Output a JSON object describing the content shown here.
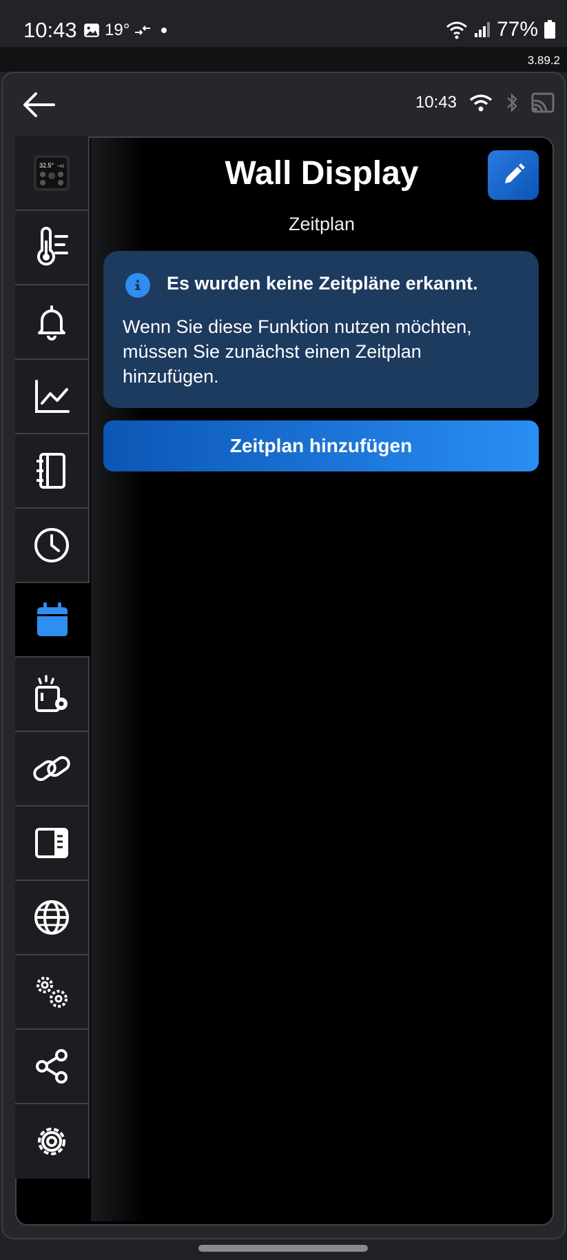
{
  "status_bar": {
    "time": "10:43",
    "temperature": "19°",
    "battery": "77%",
    "icons": [
      "image-icon",
      "swap-icon",
      "dot-icon",
      "wifi-icon",
      "signal-icon",
      "battery-icon"
    ]
  },
  "version": "3.89.2",
  "header": {
    "time": "10:43",
    "icons": [
      "back-arrow-icon",
      "wifi-icon",
      "bluetooth-icon",
      "cast-icon"
    ]
  },
  "sidebar": {
    "items": [
      {
        "name": "device-thumbnail",
        "icon": "device-thumbnail"
      },
      {
        "name": "sensors",
        "icon": "thermometer-icon"
      },
      {
        "name": "alerts",
        "icon": "bell-icon"
      },
      {
        "name": "charts",
        "icon": "chart-line-icon"
      },
      {
        "name": "notes",
        "icon": "notebook-icon"
      },
      {
        "name": "clock",
        "icon": "clock-icon"
      },
      {
        "name": "schedule",
        "icon": "calendar-icon",
        "active": true
      },
      {
        "name": "device-settings",
        "icon": "device-gear-icon"
      },
      {
        "name": "links",
        "icon": "link-icon"
      },
      {
        "name": "layout",
        "icon": "layout-icon"
      },
      {
        "name": "web",
        "icon": "globe-icon"
      },
      {
        "name": "advanced",
        "icon": "gears-icon"
      },
      {
        "name": "share",
        "icon": "share-icon"
      },
      {
        "name": "settings",
        "icon": "gear-icon"
      }
    ]
  },
  "main": {
    "title": "Wall Display",
    "subtitle": "Zeitplan",
    "info_title": "Es wurden keine Zeitpläne erkannt.",
    "info_text": "Wenn Sie diese Funktion nutzen möchten, müssen Sie zunächst einen Zeitplan hinzufügen.",
    "add_button": "Zeitplan hinzufügen"
  },
  "colors": {
    "accent": "#2a8ef4",
    "active_icon": "#2f8ef0",
    "info_bg": "#1d3a5f"
  },
  "device_thumbnail": {
    "reading": "32.5°",
    "secondary": "+45"
  }
}
